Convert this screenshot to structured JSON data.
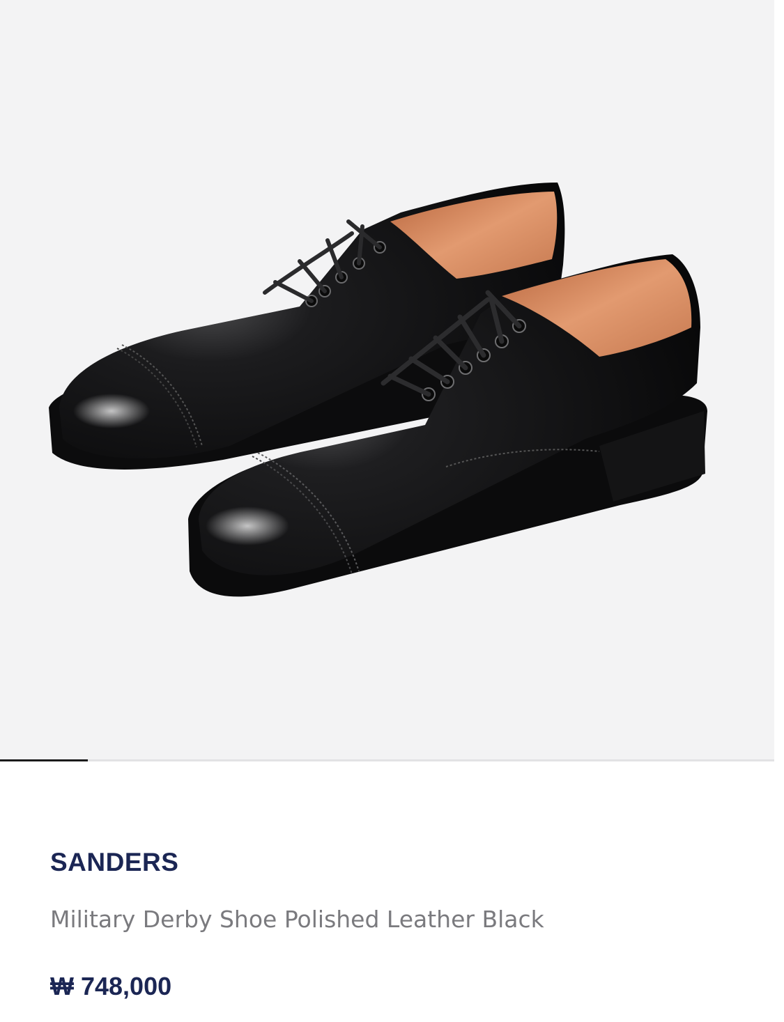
{
  "gallery": {
    "image_subject": "shoe-product-photo",
    "background_color": "#f3f3f4",
    "current_index": 1,
    "progress_fraction": 0.113
  },
  "product": {
    "brand": "SANDERS",
    "name": "Military Derby Shoe Polished Leather Black",
    "price": "₩ 748,000"
  },
  "colors": {
    "brand_text": "#1b2654",
    "name_text": "#7a7a7e",
    "progress_fill": "#1a1a1a",
    "progress_track": "#e2e2e4"
  }
}
